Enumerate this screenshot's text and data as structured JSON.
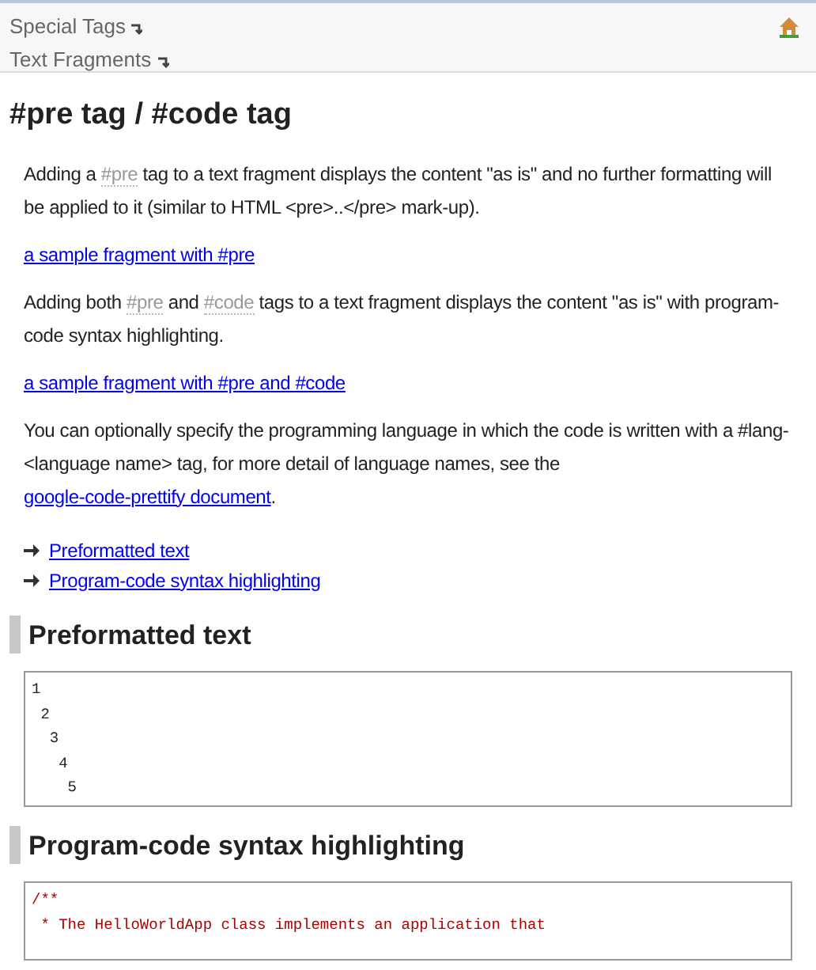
{
  "breadcrumbs": [
    {
      "label": "Special Tags"
    },
    {
      "label": "Text Fragments"
    }
  ],
  "title": "#pre tag / #code tag",
  "blocks": [
    {
      "kind": "para",
      "parts": [
        {
          "kind": "text",
          "text": "Adding a "
        },
        {
          "kind": "tag",
          "text": "#pre"
        },
        {
          "kind": "text",
          "text": " tag to a text fragment displays the content \"as is\" and no further formatting will be applied to it (similar to HTML <pre>..</pre> mark-up)."
        }
      ]
    },
    {
      "kind": "link",
      "text": "a sample fragment with #pre"
    },
    {
      "kind": "para",
      "parts": [
        {
          "kind": "text",
          "text": "Adding both "
        },
        {
          "kind": "tag",
          "text": "#pre"
        },
        {
          "kind": "text",
          "text": " and "
        },
        {
          "kind": "tag",
          "text": "#code"
        },
        {
          "kind": "text",
          "text": " tags to a text fragment displays the content \"as is\" with program-code syntax highlighting."
        }
      ]
    },
    {
      "kind": "link",
      "text": "a sample fragment with #pre and #code"
    },
    {
      "kind": "para",
      "parts": [
        {
          "kind": "text",
          "text": "You can optionally specify the programming language in which the code is written with a #lang-<language name> tag, for more detail of language names, see the "
        },
        {
          "kind": "link",
          "text": "google-code-prettify document"
        },
        {
          "kind": "text",
          "text": "."
        }
      ]
    }
  ],
  "toc": [
    {
      "label": "Preformatted text"
    },
    {
      "label": "Program-code syntax highlighting"
    }
  ],
  "sections": [
    {
      "heading": "Preformatted text",
      "kind": "pre",
      "lines": [
        "1",
        " 2",
        "  3",
        "   4",
        "    5"
      ]
    },
    {
      "heading": "Program-code syntax highlighting",
      "kind": "code",
      "lines": [
        "/**",
        " * The HelloWorldApp class implements an application that"
      ]
    }
  ]
}
